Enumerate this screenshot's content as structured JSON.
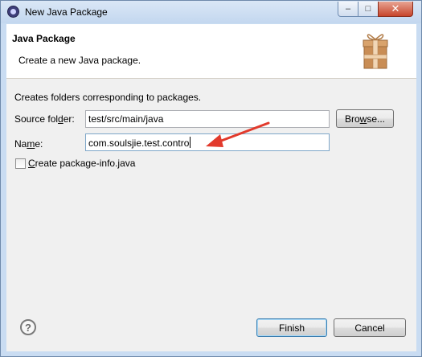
{
  "window": {
    "title": "New Java Package",
    "controls": {
      "minimize": "–",
      "maximize": "□",
      "close": "✕"
    }
  },
  "banner": {
    "title": "Java Package",
    "description": "Create a new Java package.",
    "icon": "package-icon"
  },
  "form": {
    "info": "Creates folders corresponding to packages.",
    "source_folder_label_pre": "Source fol",
    "source_folder_label_mn": "d",
    "source_folder_label_post": "er:",
    "source_folder_value": "test/src/main/java",
    "browse_pre": "Bro",
    "browse_mn": "w",
    "browse_post": "se...",
    "name_label_pre": "Na",
    "name_label_mn": "m",
    "name_label_post": "e:",
    "name_value": "com.soulsjie.test.contro",
    "checkbox_pre": "",
    "checkbox_mn": "C",
    "checkbox_post": "reate package-info.java",
    "checkbox_checked": false
  },
  "footer": {
    "help_glyph": "?",
    "finish_label": "Finish",
    "cancel_label": "Cancel"
  },
  "colors": {
    "arrow": "#e23a2c",
    "window_frame": "#c9dcf2",
    "default_button_border": "#3c7fb1"
  }
}
